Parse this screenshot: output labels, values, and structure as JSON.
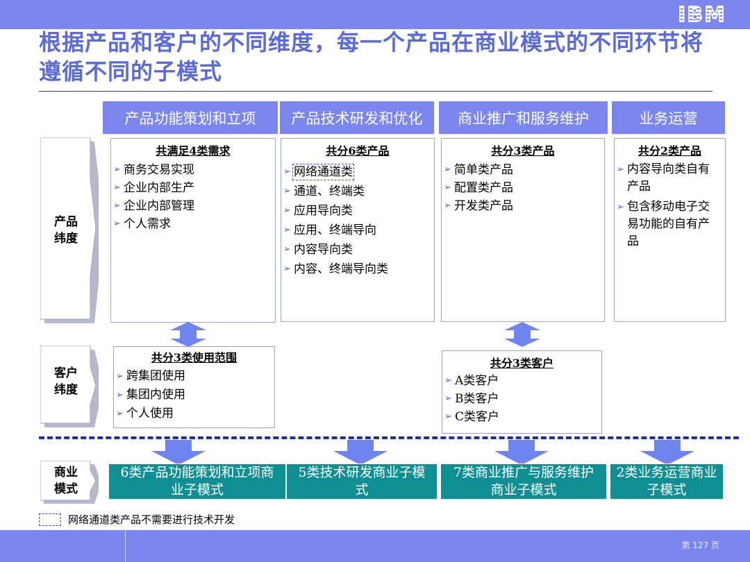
{
  "header": {
    "logo": "IBM",
    "title": "根据产品和客户的不同维度，每一个产品在商业模式的不同环节将遵循不同的子模式"
  },
  "columns": [
    "产品功能策划和立项",
    "产品技术研发和优化",
    "商业推广和服务维护",
    "业务运营"
  ],
  "rows": {
    "product": "产品\n纬度",
    "customer": "客户\n纬度",
    "business": "商业\n模式"
  },
  "product_boxes": [
    {
      "title": "共满足4类需求",
      "items": [
        "商务交易实现",
        "企业内部生产",
        "企业内部管理",
        "个人需求"
      ]
    },
    {
      "title": "共分6类产品",
      "items": [
        "网络通道类",
        "通道、终端类",
        "应用导向类",
        "应用、终端导向",
        "内容导向类",
        "内容、终端导向类"
      ]
    },
    {
      "title": "共分3类产品",
      "items": [
        "简单类产品",
        "配置类产品",
        "开发类产品"
      ]
    },
    {
      "title": "共分2类产品",
      "items": [
        "内容导向类自有产品",
        "包含移动电子交易功能的自有产品"
      ]
    }
  ],
  "customer_boxes": [
    {
      "title": "共分3类使用范围",
      "items": [
        "跨集团使用",
        "集团内使用",
        "个人使用"
      ]
    },
    {
      "title": "共分3类客户",
      "items": [
        "A类客户",
        "B类客户",
        "C类客户"
      ]
    }
  ],
  "business_models": [
    "6类产品功能策划和立项商业子模式",
    "5类技术研发商业子模式",
    "7类商业推广与服务维护商业子模式",
    "2类业务运营商业子模式"
  ],
  "note": "网络通道类产品不需要进行技术开发",
  "footer": {
    "page": "第 127 页"
  },
  "colors": {
    "banner": "#7b86ee",
    "title": "#5a6ad8",
    "teal": "#0f8f94",
    "divider": "#1b2fa0"
  }
}
